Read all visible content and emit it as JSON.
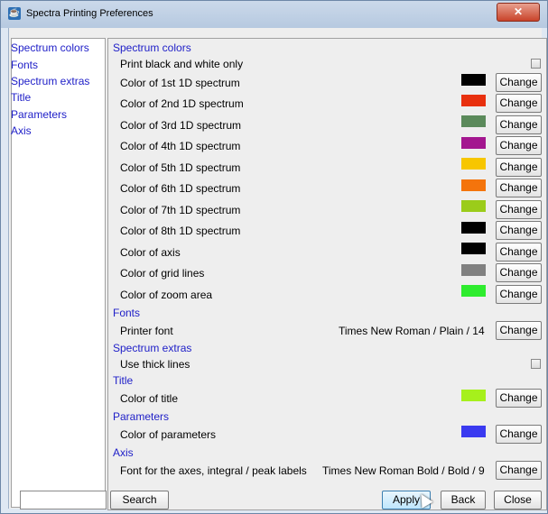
{
  "window": {
    "title": "Spectra Printing Preferences",
    "close_symbol": "✕"
  },
  "sidebar": {
    "items": [
      {
        "label": "Spectrum colors"
      },
      {
        "label": "Fonts"
      },
      {
        "label": "Spectrum extras"
      },
      {
        "label": "Title"
      },
      {
        "label": "Parameters"
      },
      {
        "label": "Axis"
      }
    ]
  },
  "sections": {
    "spectrum_colors": "Spectrum colors",
    "fonts": "Fonts",
    "spectrum_extras": "Spectrum extras",
    "title": "Title",
    "parameters": "Parameters",
    "axis": "Axis"
  },
  "rows": {
    "print_bw": "Print black and white only",
    "colors": [
      {
        "label": "Color of 1st 1D spectrum",
        "color": "#000000"
      },
      {
        "label": "Color of 2nd 1D spectrum",
        "color": "#e8300e"
      },
      {
        "label": "Color of 3rd 1D spectrum",
        "color": "#5b8a5b"
      },
      {
        "label": "Color of 4th 1D spectrum",
        "color": "#a3168f"
      },
      {
        "label": "Color of 5th 1D spectrum",
        "color": "#f7c600"
      },
      {
        "label": "Color of 6th 1D spectrum",
        "color": "#f4740c"
      },
      {
        "label": "Color of 7th 1D spectrum",
        "color": "#9bcc1a"
      },
      {
        "label": "Color of 8th 1D spectrum",
        "color": "#000000"
      },
      {
        "label": "Color of axis",
        "color": "#000000"
      },
      {
        "label": "Color of grid lines",
        "color": "#808080"
      },
      {
        "label": "Color of zoom area",
        "color": "#2eec2e"
      }
    ],
    "printer_font": {
      "label": "Printer font",
      "value": "Times New Roman / Plain / 14"
    },
    "thick_lines": "Use thick lines",
    "title_color": {
      "label": "Color of title",
      "color": "#a6f01c"
    },
    "param_color": {
      "label": "Color of parameters",
      "color": "#3a3af0"
    },
    "axis_font": {
      "label": "Font for the axes, integral / peak labels",
      "value": "Times New Roman Bold / Bold / 9"
    },
    "change_label": "Change"
  },
  "footer": {
    "search_value": "",
    "search_button": "Search",
    "apply_button": "Apply",
    "back_button": "Back",
    "close_button": "Close"
  }
}
